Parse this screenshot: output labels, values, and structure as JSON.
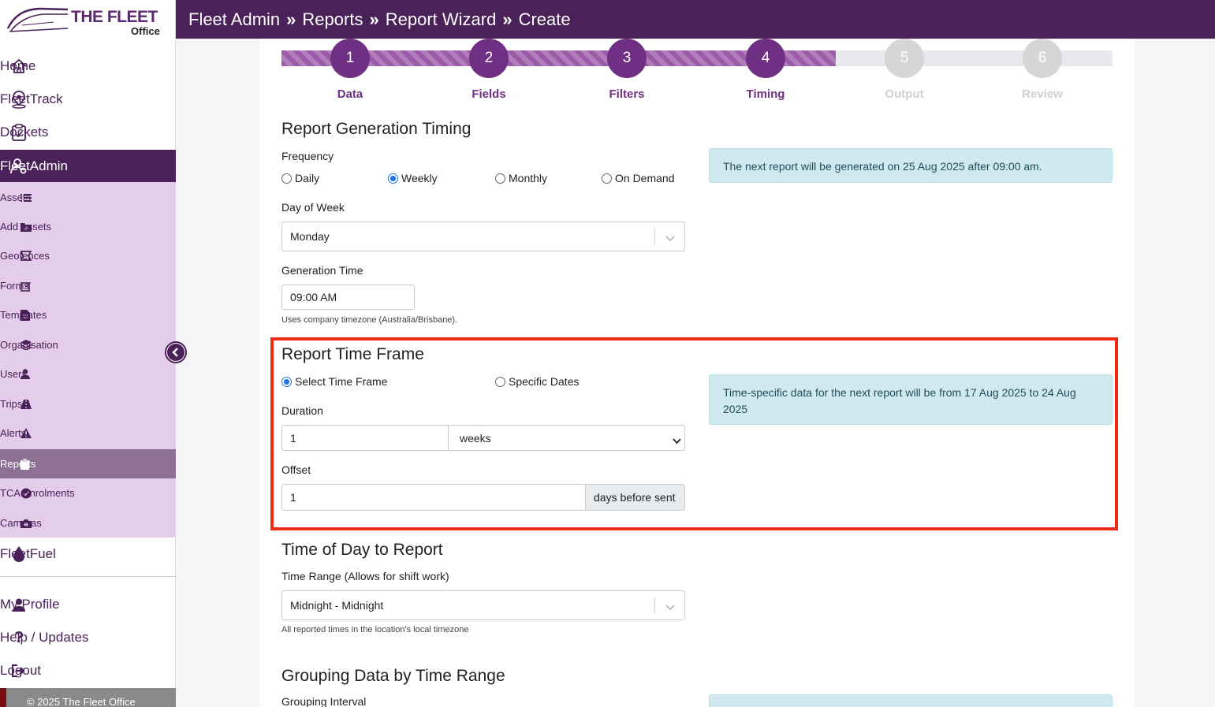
{
  "app": {
    "brand_name": "THE FLEET",
    "brand_sub": "Office"
  },
  "header": {
    "crumbs": [
      "Fleet Admin",
      "Reports",
      "Report Wizard",
      "Create"
    ],
    "separator": "»"
  },
  "sidebar": {
    "main_top": [
      {
        "label": "Home",
        "icon": "home-icon"
      },
      {
        "label": "FleetTrack",
        "icon": "map-pin-icon"
      },
      {
        "label": "Dockets",
        "icon": "clipboard-check-icon"
      },
      {
        "label": "FleetAdmin",
        "icon": "user-cog-icon",
        "active": true
      }
    ],
    "sub_items": [
      {
        "label": "Assets",
        "icon": "list-icon"
      },
      {
        "label": "Add Assets",
        "icon": "folder-plus-icon"
      },
      {
        "label": "Geofences",
        "icon": "geofence-icon"
      },
      {
        "label": "Forms",
        "icon": "edit-icon"
      },
      {
        "label": "Templates",
        "icon": "file-icon"
      },
      {
        "label": "Organisation",
        "icon": "layers-icon"
      },
      {
        "label": "Users",
        "icon": "user-icon"
      },
      {
        "label": "Trips",
        "icon": "road-icon"
      },
      {
        "label": "Alerts",
        "icon": "warning-icon"
      },
      {
        "label": "Reports",
        "icon": "clipboard-icon",
        "active": true
      },
      {
        "label": "TCA Enrolments",
        "icon": "check-circle-icon"
      },
      {
        "label": "Cameras",
        "icon": "camera-icon"
      }
    ],
    "fleetfuel": {
      "label": "FleetFuel",
      "icon": "drop-icon"
    },
    "bottom": [
      {
        "label": "My Profile",
        "icon": "user-icon"
      },
      {
        "label": "Help / Updates",
        "icon": "question-icon"
      },
      {
        "label": "Logout",
        "icon": "logout-icon"
      }
    ],
    "footer": "© 2025 The Fleet Office"
  },
  "wizard": {
    "steps": [
      {
        "num": "1",
        "label": "Data",
        "done": true
      },
      {
        "num": "2",
        "label": "Fields",
        "done": true
      },
      {
        "num": "3",
        "label": "Filters",
        "done": true
      },
      {
        "num": "4",
        "label": "Timing",
        "done": true
      },
      {
        "num": "5",
        "label": "Output",
        "done": false
      },
      {
        "num": "6",
        "label": "Review",
        "done": false
      }
    ],
    "progress_fraction": 0.667
  },
  "timing": {
    "title": "Report Generation Timing",
    "frequency_label": "Frequency",
    "frequency_options": [
      "Daily",
      "Weekly",
      "Monthly",
      "On Demand"
    ],
    "frequency_selected": "Weekly",
    "day_label": "Day of Week",
    "day_value": "Monday",
    "time_label": "Generation Time",
    "time_value": "09:00 AM",
    "time_help": "Uses company timezone (Australia/Brisbane).",
    "info": "The next report will be generated on 25 Aug 2025 after 09:00 am."
  },
  "timeframe": {
    "title": "Report Time Frame",
    "mode_options": [
      "Select Time Frame",
      "Specific Dates"
    ],
    "mode_selected": "Select Time Frame",
    "duration_label": "Duration",
    "duration_value": "1",
    "duration_unit": "weeks",
    "offset_label": "Offset",
    "offset_value": "1",
    "offset_suffix": "days before sent",
    "info": "Time-specific data for the next report will be from 17 Aug 2025 to 24 Aug 2025"
  },
  "timeofday": {
    "title": "Time of Day to Report",
    "range_label": "Time Range (Allows for shift work)",
    "range_value": "Midnight - Midnight",
    "range_help": "All reported times in the location's local timezone"
  },
  "grouping": {
    "title": "Grouping Data by Time Range",
    "interval_label": "Grouping Interval"
  },
  "colors": {
    "brand": "#4a2159",
    "accent": "#6f2f82",
    "highlight": "#ee2b16",
    "info_bg": "#cfe9ee"
  }
}
